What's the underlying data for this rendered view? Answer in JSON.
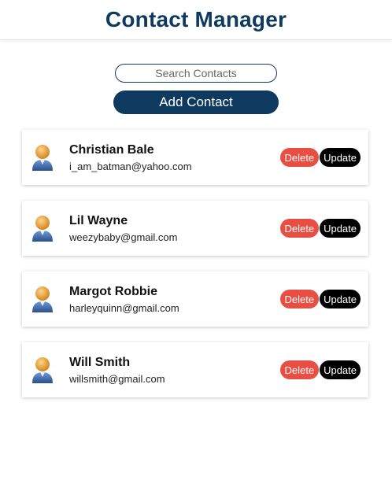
{
  "app": {
    "title": "Contact Manager"
  },
  "search": {
    "placeholder": "Search Contacts"
  },
  "toolbar": {
    "add_label": "Add Contact"
  },
  "contacts": [
    {
      "name": "Christian Bale",
      "email": "i_am_batman@yahoo.com",
      "delete_label": "Delete",
      "update_label": "Update"
    },
    {
      "name": "Lil Wayne",
      "email": "weezybaby@gmail.com",
      "delete_label": "Delete",
      "update_label": "Update"
    },
    {
      "name": "Margot Robbie",
      "email": "harleyquinn@gmail.com",
      "delete_label": "Delete",
      "update_label": "Update"
    },
    {
      "name": "Will Smith",
      "email": "willsmith@gmail.com",
      "delete_label": "Delete",
      "update_label": "Update"
    }
  ],
  "colors": {
    "brand": "#0f3a5f",
    "delete": "#e94e43",
    "update": "#000000"
  },
  "icons": {
    "avatar": "user-avatar-icon"
  }
}
